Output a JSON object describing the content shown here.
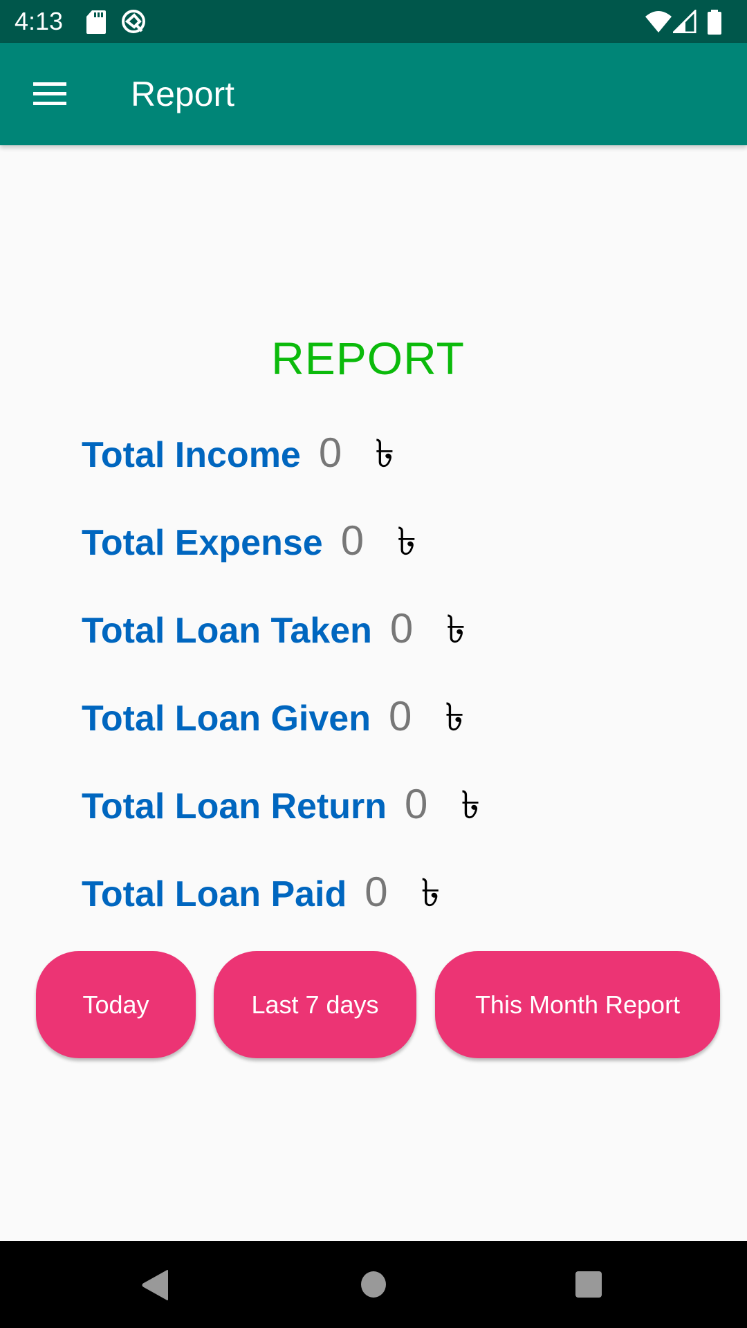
{
  "status_bar": {
    "time": "4:13",
    "left_icons": [
      "sd-card-icon",
      "data-saver-icon"
    ],
    "right_icons": [
      "wifi-icon",
      "cell-signal-icon",
      "battery-icon"
    ]
  },
  "app_bar": {
    "menu_icon": "hamburger-menu-icon",
    "title": "Report"
  },
  "main": {
    "heading": "REPORT",
    "currency_symbol": "৳",
    "rows": [
      {
        "label": "Total Income",
        "value": "0"
      },
      {
        "label": "Total Expense",
        "value": "0"
      },
      {
        "label": "Total Loan Taken",
        "value": "0"
      },
      {
        "label": "Total Loan Given",
        "value": "0"
      },
      {
        "label": "Total Loan Return",
        "value": "0"
      },
      {
        "label": "Total Loan Paid",
        "value": "0"
      }
    ],
    "buttons": [
      {
        "label": "Today"
      },
      {
        "label": "Last 7 days"
      },
      {
        "label": "This Month Report"
      }
    ]
  },
  "colors": {
    "status_bar": "#00574B",
    "app_bar": "#008577",
    "heading": "#0BBA0B",
    "label": "#0066BF",
    "value": "#777777",
    "button": "#EC3474"
  },
  "nav_bar": {
    "buttons": [
      "back-icon",
      "home-icon",
      "recents-icon"
    ]
  }
}
